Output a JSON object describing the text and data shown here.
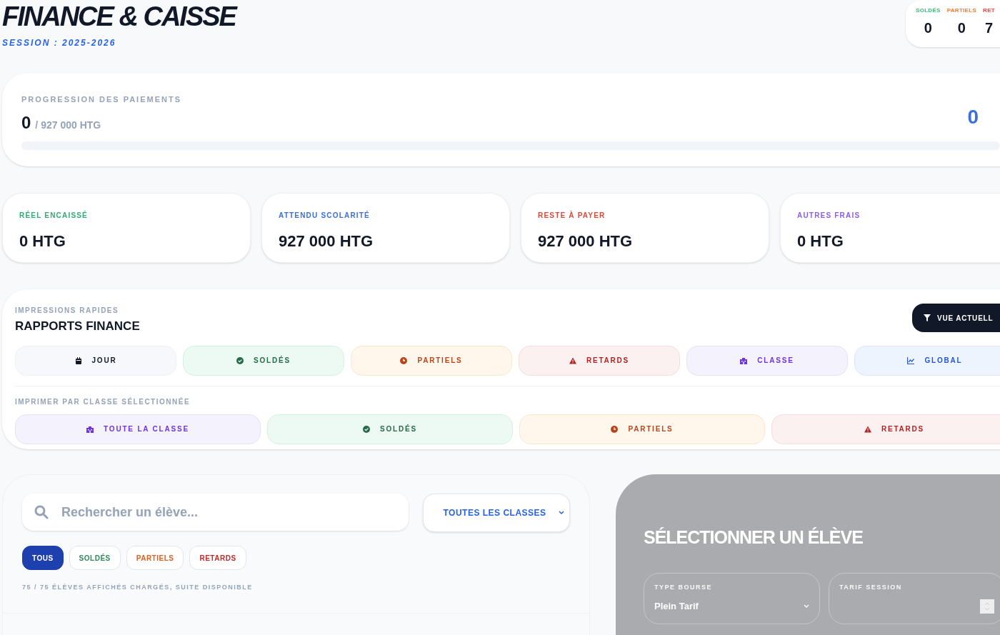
{
  "header": {
    "title": "FINANCE & CAISSE",
    "session": "SESSION : 2025-2026"
  },
  "summary": [
    {
      "label": "SOLDÉS",
      "value": "0",
      "color": "#3fb87a"
    },
    {
      "label": "PARTIELS",
      "value": "0",
      "color": "#f47c2c"
    },
    {
      "label": "RET",
      "value": "7",
      "color": "#ef4444"
    }
  ],
  "progress": {
    "title": "PROGRESSION DES PAIEMENTS",
    "amount": "0",
    "total": "/ 927 000 HTG",
    "percent": "0",
    "level": 0
  },
  "stats": [
    {
      "label": "RÉEL ENCAISSÉ",
      "value": "0 HTG",
      "color": "#34a876"
    },
    {
      "label": "ATTENDU SCOLARITÉ",
      "value": "927 000 HTG",
      "color": "#3b6fe0"
    },
    {
      "label": "RESTE À PAYER",
      "value": "927 000 HTG",
      "color": "#dc4a3a"
    },
    {
      "label": "AUTRES FRAIS",
      "value": "0 HTG",
      "color": "#8b5cf6"
    }
  ],
  "reports": {
    "eyebrow": "IMPRESSIONS RAPIDES",
    "title": "RAPPORTS FINANCE",
    "view_button": "VUE ACTUELL",
    "quick": [
      {
        "label": "JOUR",
        "kind": "day"
      },
      {
        "label": "SOLDÉS",
        "kind": "paid"
      },
      {
        "label": "PARTIELS",
        "kind": "partial"
      },
      {
        "label": "RETARDS",
        "kind": "late"
      },
      {
        "label": "CLASSE",
        "kind": "class"
      },
      {
        "label": "GLOBAL",
        "kind": "global"
      }
    ],
    "by_class_title": "IMPRIMER PAR CLASSE SÉLECTIONNÉE",
    "by_class": [
      {
        "label": "TOUTE LA CLASSE",
        "kind": "class"
      },
      {
        "label": "SOLDÉS",
        "kind": "paid"
      },
      {
        "label": "PARTIELS",
        "kind": "partial"
      },
      {
        "label": "RETARDS",
        "kind": "late"
      }
    ]
  },
  "students": {
    "search_placeholder": "Rechercher un élève...",
    "class_select": "TOUTES LES CLASSES",
    "filters": [
      {
        "label": "TOUS",
        "kind": "all",
        "selected": true
      },
      {
        "label": "SOLDÉS",
        "kind": "paid",
        "selected": false
      },
      {
        "label": "PARTIELS",
        "kind": "partial",
        "selected": false
      },
      {
        "label": "RETARDS",
        "kind": "late",
        "selected": false
      }
    ],
    "count": "75 / 75 ÉLÈVES AFFICHÉS CHARGÉS, SUITE DISPONIBLE"
  },
  "detail": {
    "title": "SÉLECTIONNER UN ÉLÈVE",
    "fields": [
      {
        "label": "TYPE BOURSE",
        "value": "Plein Tarif",
        "kind": "select"
      },
      {
        "label": "TARIF SESSION",
        "kind": "number"
      }
    ]
  }
}
